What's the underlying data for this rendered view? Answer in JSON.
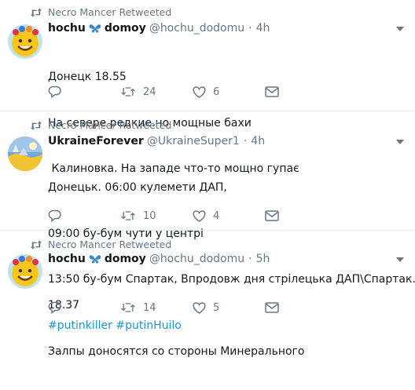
{
  "colors": {
    "link": "#1b95e0",
    "meta": "#657786",
    "text": "#14171a",
    "divider": "#e6ecf0"
  },
  "tweets": [
    {
      "retweeted_by": "Necro Mancer Retweeted",
      "name_part1": "hochu",
      "name_part2": "domoy",
      "handle": "@hochu_dodomu",
      "separator": "·",
      "time": "4h",
      "lines": [
        "Донецк 18.55",
        "На севере редкие.но мощные бахи",
        " Калиновка. На западе что-то мощно гупає"
      ],
      "replies": "",
      "retweets": "24",
      "likes": "6"
    },
    {
      "retweeted_by": "Necro Mancer Retweeted",
      "name": "UkraineForever",
      "handle": "@UkraineSuper1",
      "separator": "·",
      "time": "4h",
      "lines": [
        "Донецьк. 06:00 кулемети ДАП,",
        "09:00 бу-бум чути у центрі",
        "13:50 бу-бум Спартак, Впродовж дня стрілецька ДАП\\Спартак.."
      ],
      "hashtags": [
        "#putinkiller",
        "#putinHuilo"
      ],
      "replies": "",
      "retweets": "10",
      "likes": "4"
    },
    {
      "retweeted_by": "Necro Mancer Retweeted",
      "name_part1": "hochu",
      "name_part2": "domoy",
      "handle": "@hochu_dodomu",
      "separator": "·",
      "time": "5h",
      "lines": [
        "18.37",
        "Залпы доносятся со стороны Минерального"
      ],
      "replies": "",
      "retweets": "14",
      "likes": "5"
    }
  ]
}
